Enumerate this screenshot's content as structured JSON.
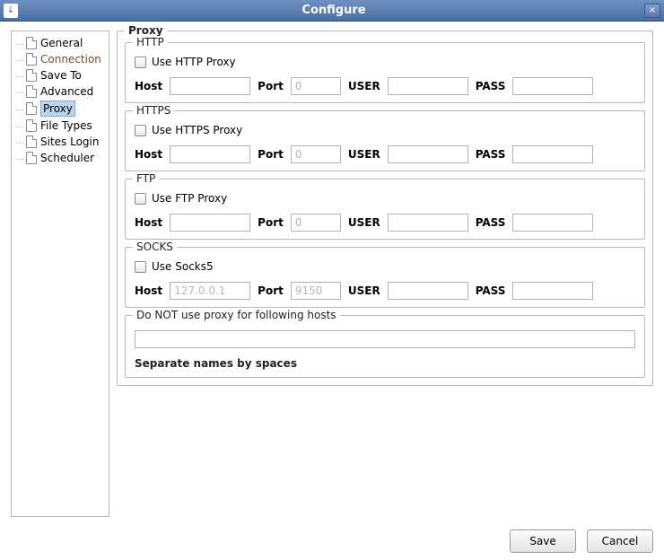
{
  "window": {
    "title": "Configure",
    "close_glyph": "×",
    "app_icon_glyph": "↓"
  },
  "sidebar": {
    "items": [
      {
        "label": "General"
      },
      {
        "label": "Connection"
      },
      {
        "label": "Save To"
      },
      {
        "label": "Advanced"
      },
      {
        "label": "Proxy"
      },
      {
        "label": "File Types"
      },
      {
        "label": "Sites Login"
      },
      {
        "label": "Scheduler"
      }
    ],
    "selected_index": 4
  },
  "panel": {
    "title": "Proxy",
    "sections": {
      "http": {
        "legend": "HTTP",
        "checkbox_label": "Use HTTP Proxy",
        "checked": false,
        "host_label": "Host",
        "host": "",
        "port_label": "Port",
        "port": "",
        "port_placeholder": "0",
        "user_label": "USER",
        "user": "",
        "pass_label": "PASS",
        "pass": ""
      },
      "https": {
        "legend": "HTTPS",
        "checkbox_label": "Use HTTPS Proxy",
        "checked": false,
        "host_label": "Host",
        "host": "",
        "port_label": "Port",
        "port": "",
        "port_placeholder": "0",
        "user_label": "USER",
        "user": "",
        "pass_label": "PASS",
        "pass": ""
      },
      "ftp": {
        "legend": "FTP",
        "checkbox_label": "Use FTP Proxy",
        "checked": false,
        "host_label": "Host",
        "host": "",
        "port_label": "Port",
        "port": "",
        "port_placeholder": "0",
        "user_label": "USER",
        "user": "",
        "pass_label": "PASS",
        "pass": ""
      },
      "socks": {
        "legend": "SOCKS",
        "checkbox_label": "Use Socks5",
        "checked": false,
        "host_label": "Host",
        "host": "",
        "host_placeholder": "127.0.0.1",
        "port_label": "Port",
        "port": "",
        "port_placeholder": "9150",
        "user_label": "USER",
        "user": "",
        "pass_label": "PASS",
        "pass": ""
      },
      "noproxy": {
        "legend": "Do NOT use proxy for following hosts",
        "value": "",
        "hint": "Separate names by spaces"
      }
    }
  },
  "buttons": {
    "save": "Save",
    "cancel": "Cancel"
  }
}
